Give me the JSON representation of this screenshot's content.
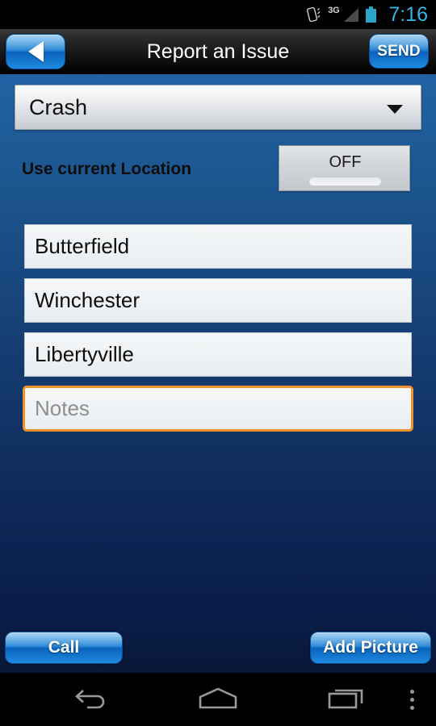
{
  "status_bar": {
    "vibrate_icon": "vibrate-icon",
    "network_label": "3G",
    "signal_icon": "signal-bars-icon",
    "battery_icon": "battery-icon",
    "time": "7:16",
    "time_color": "#33b5e5"
  },
  "title_bar": {
    "back_icon": "back-triangle-icon",
    "title": "Report an Issue",
    "send_label": "SEND"
  },
  "form": {
    "issue_type": {
      "selected": "Crash",
      "caret_icon": "chevron-down-icon"
    },
    "location": {
      "label": "Use current Location",
      "toggle_state": "OFF"
    },
    "fields": [
      {
        "name": "address-line-1",
        "value": "Butterfield"
      },
      {
        "name": "address-line-2",
        "value": "Winchester"
      },
      {
        "name": "address-line-3",
        "value": "Libertyville"
      }
    ],
    "notes": {
      "placeholder": "Notes",
      "value": "",
      "focus_color": "#f0922b"
    }
  },
  "actions": {
    "call_label": "Call",
    "add_picture_label": "Add Picture"
  },
  "nav_bar": {
    "back_icon": "android-back-icon",
    "home_icon": "android-home-icon",
    "recents_icon": "android-recents-icon",
    "menu_icon": "overflow-menu-icon"
  },
  "theme": {
    "background_top": "#2263a5",
    "background_bottom": "#081838",
    "accent_blue": "#1a7fd4",
    "accent_orange": "#f0922b"
  }
}
